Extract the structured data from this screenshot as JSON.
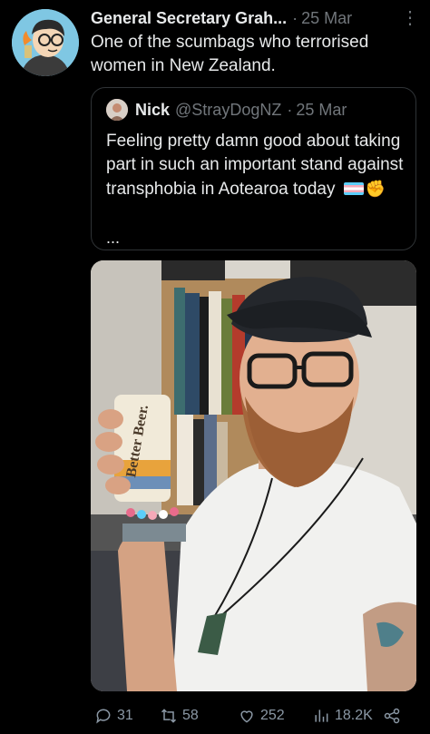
{
  "post": {
    "author_name": "General Secretary Grah...",
    "separator": "·",
    "date": "25 Mar",
    "more": "⋮",
    "text": "One of the scumbags who terrorised women in New Zealand."
  },
  "quote": {
    "name": "Nick",
    "handle": "@StrayDogNZ",
    "separator": "·",
    "date": "25 Mar",
    "text": "Feeling pretty damn good about taking part in such an important stand against transphobia in Aotearoa today",
    "ellipsis": "..."
  },
  "photo": {
    "can_text": "Better Beer."
  },
  "actions": {
    "replies": "31",
    "reposts": "58",
    "likes": "252",
    "views": "18.2K"
  },
  "icons": [
    "reply-icon",
    "repost-icon",
    "like-icon",
    "views-icon",
    "share-icon",
    "more-icon"
  ]
}
